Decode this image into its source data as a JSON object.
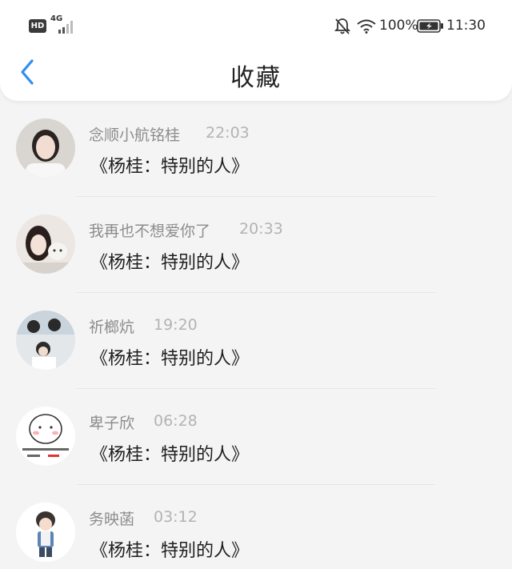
{
  "status_bar": {
    "hd_label": "HD",
    "network_label": "4G",
    "battery_percent": "100%",
    "time": "11:30",
    "icons": [
      "signal-icon",
      "bell-off-icon",
      "wifi-icon",
      "battery-charging-icon"
    ]
  },
  "header": {
    "back_icon": "chevron-left-icon",
    "title": "收藏",
    "accent_color": "#2f8ff0"
  },
  "messages": [
    {
      "sender": "念顺小航铭桂",
      "time": "22:03",
      "content": "《杨桂：特别的人》"
    },
    {
      "sender": "我再也不想爱你了",
      "time": "20:33",
      "content": "《杨桂：特别的人》"
    },
    {
      "sender": "祈榔炕",
      "time": "19:20",
      "content": "《杨桂：特别的人》"
    },
    {
      "sender": "卑子欣",
      "time": "06:28",
      "content": "《杨桂：特别的人》"
    },
    {
      "sender": "务映菡",
      "time": "03:12",
      "content": "《杨桂：特别的人》"
    }
  ]
}
